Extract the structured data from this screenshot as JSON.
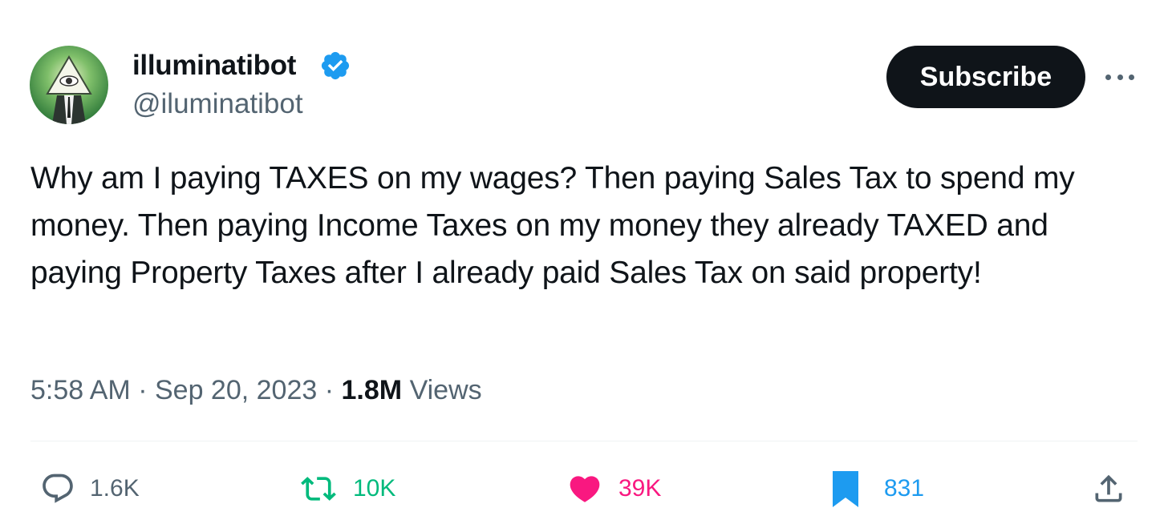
{
  "author": {
    "display_name": "illuminatibot",
    "handle": "@iluminatibot",
    "verified": true,
    "avatar_icon": "illuminati-eye-pyramid-icon"
  },
  "subscribe_label": "Subscribe",
  "tweet": {
    "text": "Why am I paying TAXES on my wages? Then paying Sales Tax to spend my money. Then paying Income Taxes on my money they already TAXED and paying Property Taxes after I already paid Sales Tax on said property!",
    "time": "5:58 AM",
    "date": "Sep 20, 2023",
    "views_count": "1.8M",
    "views_label": "Views",
    "separator": "·"
  },
  "actions": {
    "replies": "1.6K",
    "retweets": "10K",
    "likes": "39K",
    "bookmarks": "831"
  },
  "colors": {
    "text": "#0f1419",
    "secondary": "#536471",
    "verified": "#1d9bf0",
    "retweet": "#00ba7c",
    "like": "#f91880",
    "bookmark": "#1d9bf0",
    "button_bg": "#0f1419"
  }
}
